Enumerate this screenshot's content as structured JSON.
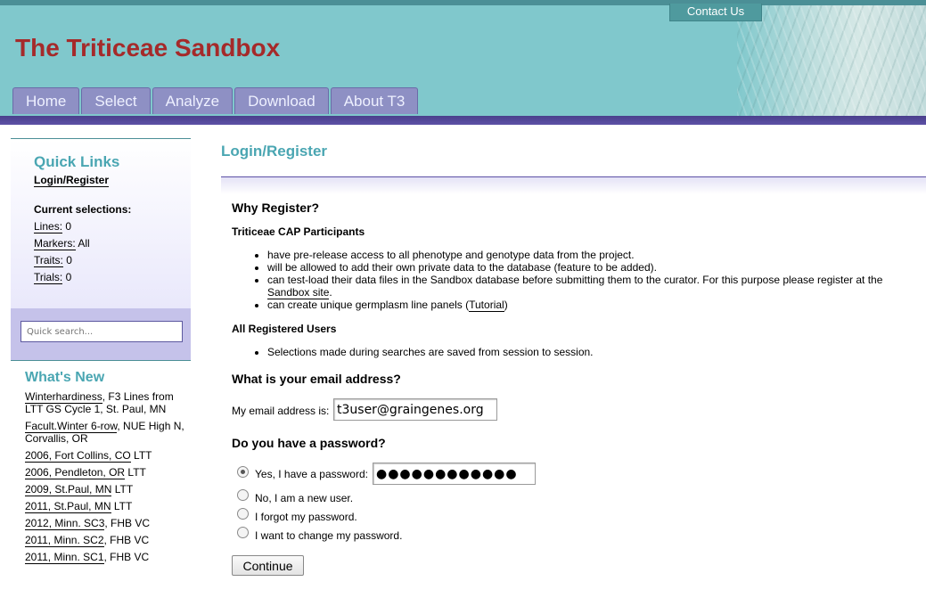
{
  "header": {
    "site_title": "The Triticeae Sandbox",
    "contact_label": "Contact Us",
    "tabs": [
      "Home",
      "Select",
      "Analyze",
      "Download",
      "About T3"
    ]
  },
  "sidebar": {
    "quick_links_heading": "Quick Links",
    "login_link": "Login/Register",
    "current_selections_heading": "Current selections:",
    "selections": [
      {
        "label": "Lines:",
        "value": " 0"
      },
      {
        "label": "Markers:",
        "value": " All"
      },
      {
        "label": "Traits:",
        "value": " 0"
      },
      {
        "label": "Trials:",
        "value": " 0"
      }
    ],
    "search_placeholder": "Quick search...",
    "whats_new_heading": "What's New",
    "news": [
      {
        "link": "Winterhardiness",
        "rest": ", F3 Lines from LTT GS Cycle 1, St. Paul, MN"
      },
      {
        "link": "Facult.Winter 6-row",
        "rest": ", NUE High N, Corvallis, OR"
      },
      {
        "link": "2006, Fort Collins, CO",
        "rest": " LTT"
      },
      {
        "link": "2006, Pendleton, OR",
        "rest": " LTT"
      },
      {
        "link": "2009, St.Paul, MN",
        "rest": " LTT"
      },
      {
        "link": "2011, St.Paul, MN",
        "rest": " LTT"
      },
      {
        "link": "2012, Minn. SC3",
        "rest": ", FHB VC"
      },
      {
        "link": "2011, Minn. SC2",
        "rest": ", FHB VC"
      },
      {
        "link": "2011, Minn. SC1",
        "rest": ", FHB VC"
      }
    ]
  },
  "main": {
    "title": "Login/Register",
    "why_register": "Why Register?",
    "cap_heading": "Triticeae CAP Participants",
    "cap_items": {
      "i1": "have pre-release access to all phenotype and genotype data from the project.",
      "i2": "will be allowed to add their own private data to the database (feature to be added).",
      "i3_pre": "can test-load their data files in the Sandbox database before submitting them to the curator. For this purpose please register at the ",
      "i3_link": "Sandbox site",
      "i3_post": ".",
      "i4_pre": "can create unique germplasm line panels (",
      "i4_link": "Tutorial",
      "i4_post": ")"
    },
    "all_users_heading": "All Registered Users",
    "all_users_item": "Selections made during searches are saved from session to session.",
    "email_question": "What is your email address?",
    "email_label": "My email address is:",
    "email_value": "t3user@graingenes.org",
    "password_question": "Do you have a password?",
    "radio_options": [
      "Yes, I have a password:",
      "No, I am a new user.",
      "I forgot my password.",
      "I want to change my password."
    ],
    "password_value": "●●●●●●●●●●●●",
    "continue_label": "Continue"
  }
}
